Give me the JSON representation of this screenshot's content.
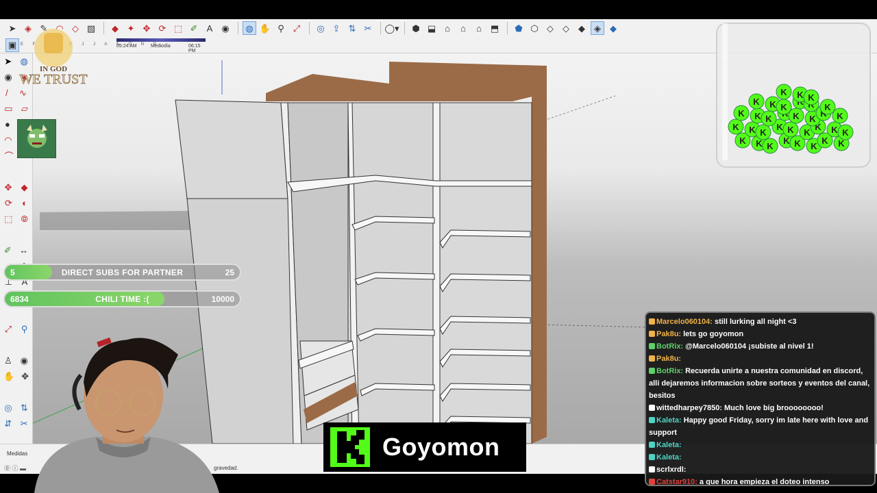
{
  "shadow_settings": {
    "months": "E F M A M J J A S O N D",
    "time_start": "05:24 AM",
    "time_mid": "Mediodía",
    "time_end": "06:15 PM"
  },
  "statusbar": {
    "measure_label": "Medidas",
    "hint_text": "gravedad."
  },
  "logo": {
    "line1": "IN GOD",
    "line2": "WE TRUST"
  },
  "goals": [
    {
      "current": "5",
      "name": "DIRECT SUBS FOR PARTNER",
      "target": "25",
      "progress": 0.2
    },
    {
      "current": "6834",
      "name": "CHILI TIME :(",
      "target": "10000",
      "progress": 0.68
    }
  ],
  "chat": {
    "messages": [
      {
        "user": "Marcelo060104:",
        "text": "still lurking all night <3",
        "user_color": "#f0b24a"
      },
      {
        "user": "Pak8u:",
        "text": "lets go goyomon",
        "user_color": "#f0b24a"
      },
      {
        "user": "BotRix:",
        "text": "@Marcelo060104 ¡subiste al nivel 1!",
        "user_color": "#5fd06a"
      },
      {
        "user": "Pak8u:",
        "text": "",
        "user_color": "#f0b24a"
      },
      {
        "user": "BotRix:",
        "text": "Recuerda unirte a nuestra comunidad en discord, alli dejaremos informacion sobre sorteos y eventos del canal, besitos",
        "user_color": "#5fd06a"
      },
      {
        "user": "wittedharpey7850:",
        "text": "Much love big broooooooo!",
        "user_color": "#ffffff"
      },
      {
        "user": "Kaleta:",
        "text": "Happy good Friday, sorry im late here with love and support",
        "user_color": "#4fd3c4"
      },
      {
        "user": "Kaleta:",
        "text": "",
        "user_color": "#4fd3c4"
      },
      {
        "user": "Kaleta:",
        "text": "",
        "user_color": "#4fd3c4"
      },
      {
        "user": "scrlxrdl:",
        "text": "",
        "user_color": "#ffffff"
      },
      {
        "user": "Catstar910:",
        "text": "a que hora empieza el doteo intenso peeeeeeeeeee",
        "user_color": "#e0413d"
      }
    ]
  },
  "streamer": {
    "name": "Goyomon"
  },
  "colors": {
    "kick_green": "#53fc18",
    "goal_fill": "#62c35e",
    "wood": "#9b6b47"
  }
}
